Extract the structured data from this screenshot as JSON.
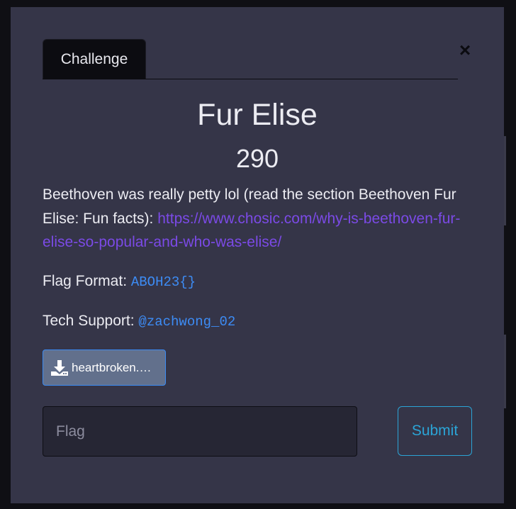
{
  "modal": {
    "tab_label": "Challenge",
    "close_label": "×",
    "title": "Fur Elise",
    "points": "290",
    "description": {
      "text": "Beethoven was really petty lol (read the section Beethoven Fur Elise: Fun facts): ",
      "link": "https://www.chosic.com/why-is-beethoven-fur-elise-so-popular-and-who-was-elise/"
    },
    "flag_format": {
      "label": "Flag Format: ",
      "value": "ABOH23{}"
    },
    "tech_support": {
      "label": "Tech Support: ",
      "value": "@zachwong_02"
    },
    "file": {
      "icon": "download-icon",
      "name": "heartbroken.wav"
    },
    "flag_input": {
      "placeholder": "Flag",
      "value": ""
    },
    "submit_label": "Submit"
  },
  "colors": {
    "modal_bg": "#353548",
    "link": "#7b4ae6",
    "code": "#3d8cf5",
    "submit": "#2ba4d6",
    "file_button": "#62708c"
  }
}
